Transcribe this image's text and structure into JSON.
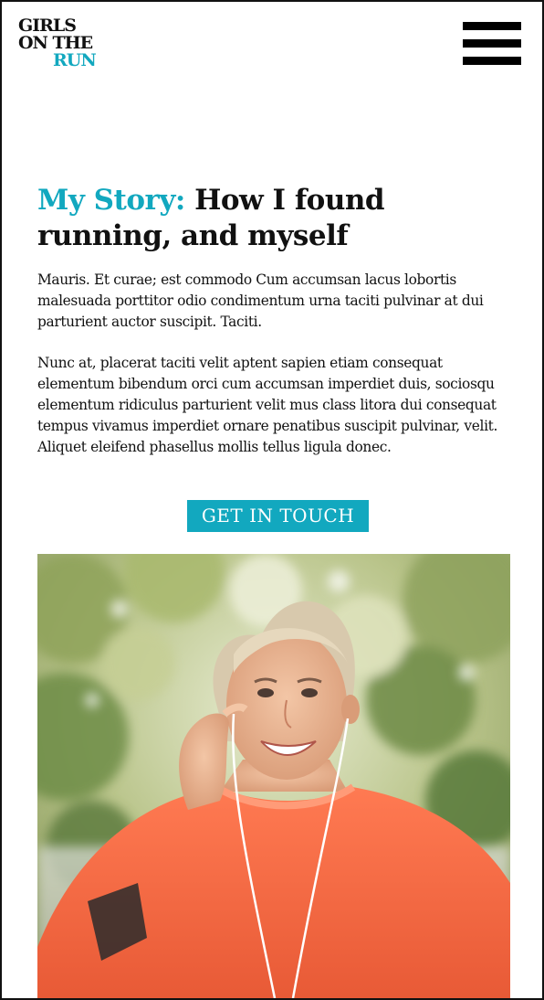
{
  "header": {
    "logo": {
      "line1": "GIRLS",
      "line2": "ON THE",
      "line3": "RUN"
    },
    "menu_icon": "hamburger-menu-icon"
  },
  "article": {
    "title_prefix": "My Story:",
    "title_main": "How I found running, and myself",
    "paragraph1": "Mauris. Et curae; est commodo Cum accumsan lacus lobortis malesuada porttitor odio condimentum urna taciti pulvinar at dui parturient auctor suscipit. Taciti.",
    "paragraph2": "Nunc at, placerat taciti velit aptent sapien etiam consequat elementum bibendum orci cum accumsan imperdiet duis, sociosqu elementum ridiculus parturient velit mus class litora dui consequat tempus vivamus imperdiet ornare penatibus suscipit pulvinar, velit. Aliquet eleifend phasellus mollis tellus ligula donec.",
    "cta_label": "GET IN TOUCH"
  },
  "hero_image": {
    "subject": "smiling woman runner in orange shirt with earphones"
  },
  "colors": {
    "accent": "#12a8bf",
    "text": "#111111",
    "background": "#ffffff"
  }
}
